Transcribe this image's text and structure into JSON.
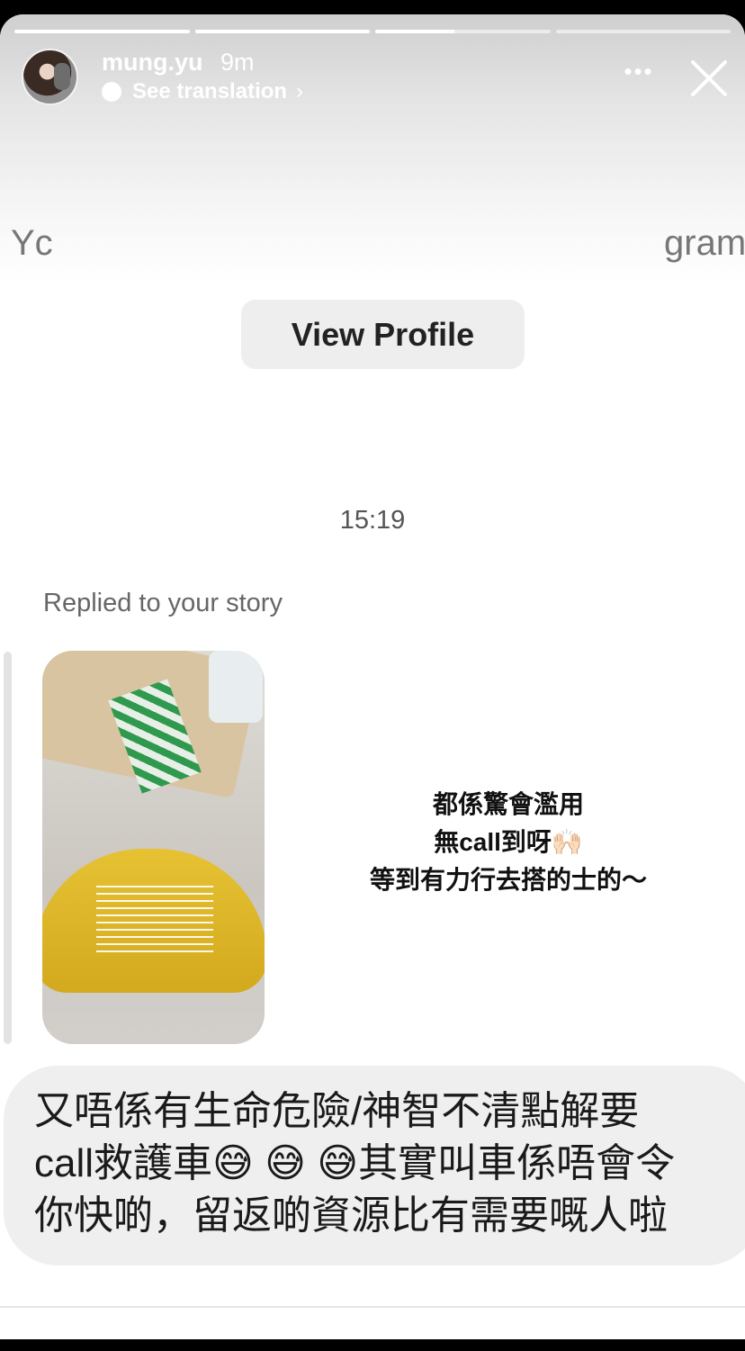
{
  "progress": [
    1.0,
    1.0,
    0.45,
    0.0
  ],
  "header": {
    "username": "mung.yu",
    "time": "9m",
    "translate_label": "See translation",
    "more_label": "•••"
  },
  "background_text": {
    "left_fragment": "Yc",
    "right_fragment": "gram"
  },
  "view_profile_label": "View Profile",
  "timestamp": "15:19",
  "replied_label": "Replied to your story",
  "story_caption_lines": [
    "都係驚會濫用",
    "無call到呀🙌🏻",
    "等到有力行去搭的士的～"
  ],
  "message_lines": [
    "又唔係有生命危險/神智不清點解要",
    "call救護車😅 😅 😅其實叫車係唔會令",
    "你快啲，留返啲資源比有需要嘅人啦"
  ]
}
